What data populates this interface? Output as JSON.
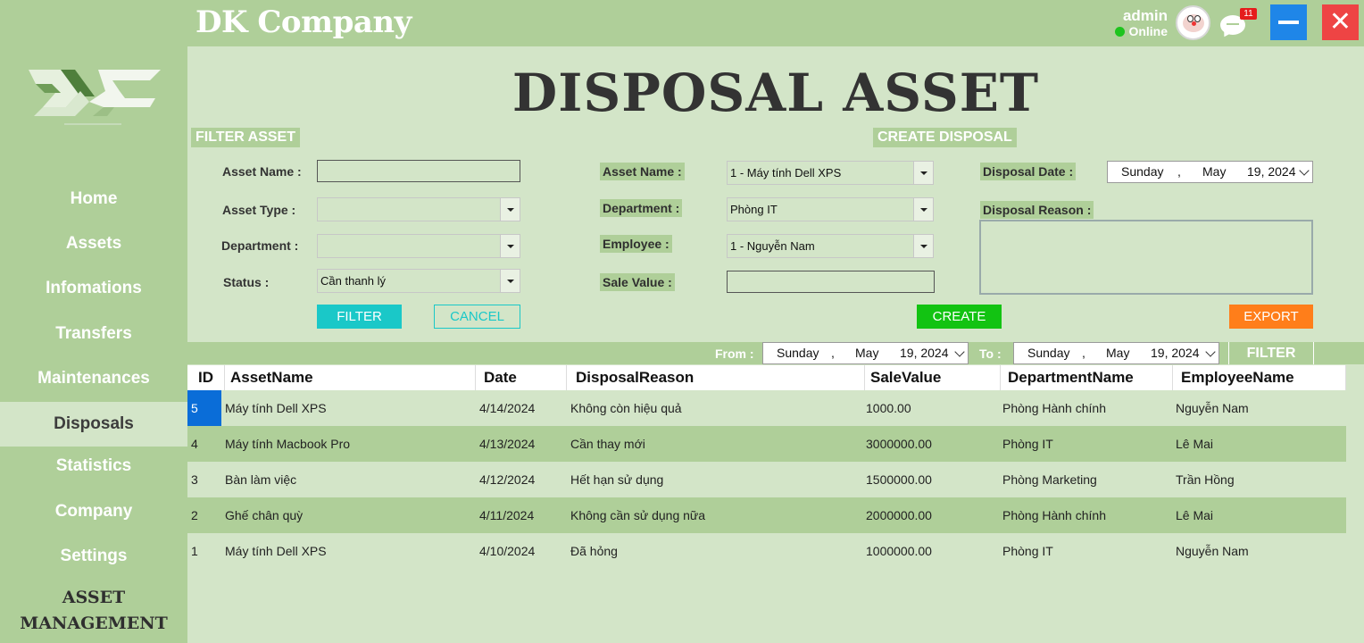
{
  "app": {
    "brand": "DK Company",
    "user": "admin",
    "status": "Online",
    "notification_count": "11",
    "close_symbol": "✕"
  },
  "sidebar": {
    "logo_icon": "dk-logo-icon",
    "items": [
      {
        "label": "Home"
      },
      {
        "label": "Assets"
      },
      {
        "label": "Infomations"
      },
      {
        "label": "Transfers"
      },
      {
        "label": "Maintenances"
      },
      {
        "label": "Disposals"
      },
      {
        "label": "Statistics"
      },
      {
        "label": "Company"
      },
      {
        "label": "Settings"
      }
    ],
    "active": "Disposals",
    "footer_line1": "ASSET",
    "footer_line2": "MANAGEMENT"
  },
  "page": {
    "title": "DISPOSAL ASSET"
  },
  "filter": {
    "section": "FILTER ASSET",
    "asset_name_label": "Asset Name :",
    "asset_type_label": "Asset Type :",
    "department_label": "Department :",
    "status_label": "Status :",
    "asset_name_value": "",
    "asset_type_value": "",
    "department_value": "",
    "status_value": "Cần thanh lý",
    "filter_button": "FILTER",
    "cancel_button": "CANCEL"
  },
  "create": {
    "section": "CREATE DISPOSAL",
    "asset_name_label": "Asset Name :",
    "department_label": "Department :",
    "employee_label": "Employee :",
    "sale_value_label": "Sale Value :",
    "disposal_date_label": "Disposal Date :",
    "disposal_reason_label": "Disposal Reason :",
    "asset_name_value": "1 - Máy tính Dell XPS",
    "department_value": "Phòng IT",
    "employee_value": "1 - Nguyễn Nam",
    "sale_value": "",
    "disposal_reason": "",
    "date": {
      "day": "Sunday",
      "sep": ",",
      "month": "May",
      "date": "19, 2024"
    },
    "create_button": "CREATE",
    "export_button": "EXPORT"
  },
  "range": {
    "from_label": "From :",
    "to_label": "To :",
    "from": {
      "day": "Sunday",
      "sep": ",",
      "month": "May",
      "date": "19, 2024"
    },
    "to": {
      "day": "Sunday",
      "sep": ",",
      "month": "May",
      "date": "19, 2024"
    },
    "filter_button": "FILTER"
  },
  "table": {
    "columns": [
      "ID",
      "AssetName",
      "Date",
      "DisposalReason",
      "SaleValue",
      "DepartmentName",
      "EmployeeName"
    ],
    "rows": [
      {
        "id": "5",
        "asset": "Máy tính Dell XPS",
        "date": "4/14/2024",
        "reason": "Không còn hiệu quả",
        "sale": "1000.00",
        "dept": "Phòng Hành chính",
        "employee": "Nguyễn Nam"
      },
      {
        "id": "4",
        "asset": "Máy tính Macbook Pro",
        "date": "4/13/2024",
        "reason": "Cần thay mới",
        "sale": "3000000.00",
        "dept": "Phòng IT",
        "employee": "Lê Mai"
      },
      {
        "id": "3",
        "asset": "Bàn làm việc",
        "date": "4/12/2024",
        "reason": "Hết hạn sử dụng",
        "sale": "1500000.00",
        "dept": "Phòng Marketing",
        "employee": "Trần Hồng"
      },
      {
        "id": "2",
        "asset": "Ghế chân quỳ",
        "date": "4/11/2024",
        "reason": "Không cần sử dụng nữa",
        "sale": "2000000.00",
        "dept": "Phòng Hành chính",
        "employee": "Lê Mai"
      },
      {
        "id": "1",
        "asset": "Máy tính Dell XPS",
        "date": "4/10/2024",
        "reason": "Đã hỏng",
        "sale": "1000000.00",
        "dept": "Phòng IT",
        "employee": "Nguyễn Nam"
      }
    ]
  },
  "colors": {
    "sidebar": "#afcf99",
    "content": "#d3e5c8",
    "filter_button": "#1ac8c8",
    "create_button": "#12c312",
    "export_button": "#ff7e1a",
    "minimize_button": "#1f86e8",
    "close_button": "#ee4444",
    "selected_cell": "#0a6dd8"
  }
}
